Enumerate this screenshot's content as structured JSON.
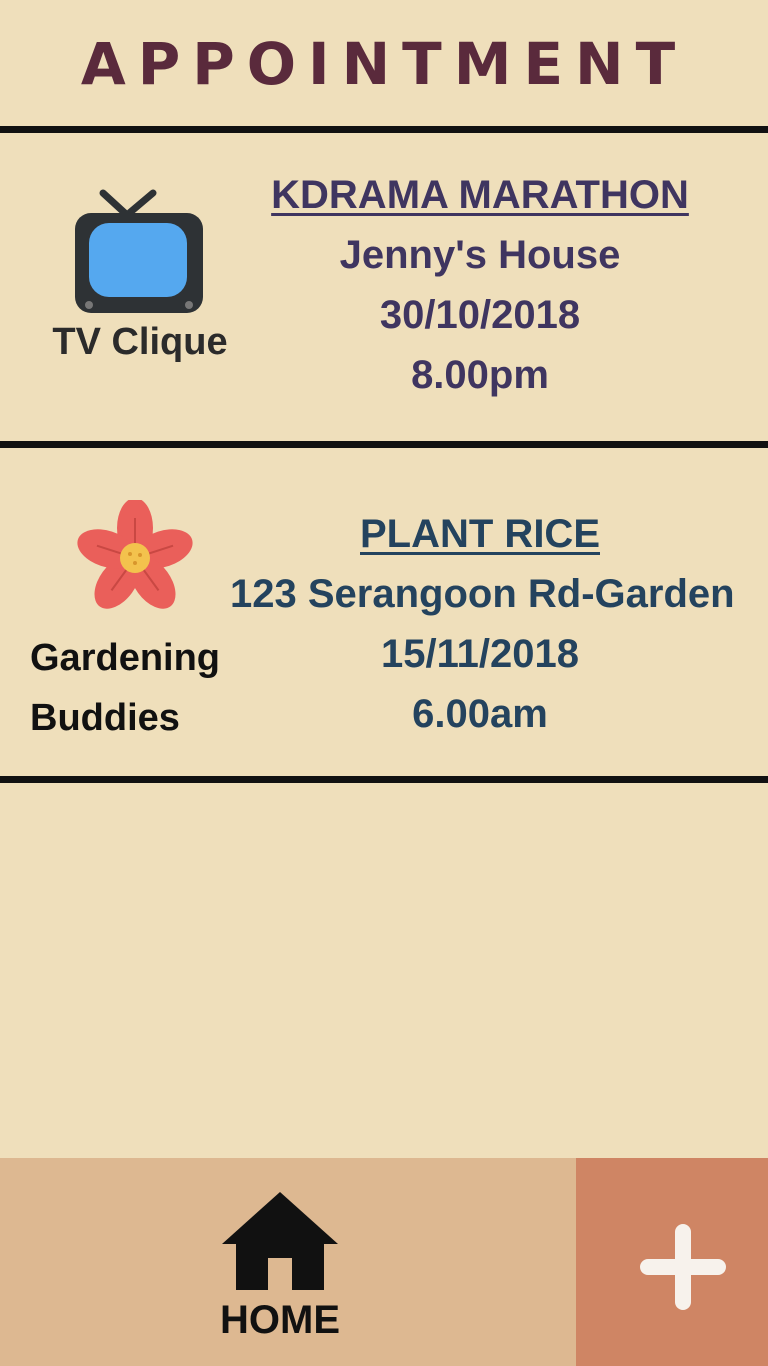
{
  "header": {
    "title": "APPOINTMENT"
  },
  "appointments": [
    {
      "group": "TV Clique",
      "icon": "tv-icon",
      "event_name": "KDRAMA MARATHON",
      "location": "Jenny's House",
      "date": "30/10/2018",
      "time": "8.00pm",
      "text_color": "#3f3560",
      "group_color": "#2b2b2b"
    },
    {
      "group_lines": [
        "Gardening",
        "Buddies"
      ],
      "icon": "flower-icon",
      "event_name": "PLANT RICE",
      "location": "123 Serangoon Rd-Garden",
      "date": "15/11/2018",
      "time": "6.00am",
      "text_color": "#24435e",
      "group_color": "#111111"
    }
  ],
  "nav": {
    "home_label": "HOME",
    "home_icon": "home-icon",
    "add_icon": "plus-icon"
  },
  "colors": {
    "background": "#efdfbb",
    "home_bar": "#ddb891",
    "add_button": "#cf8564",
    "title": "#5a2a3c"
  }
}
